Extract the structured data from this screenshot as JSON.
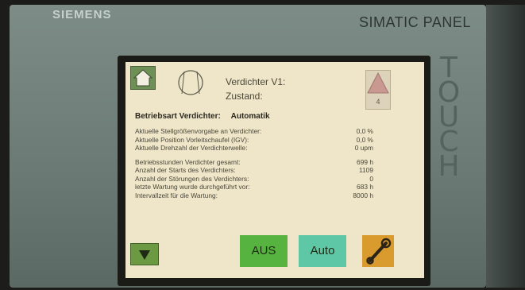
{
  "device": {
    "brand": "SIEMENS",
    "model": "SIMATIC PANEL",
    "side_label": "TOUCH"
  },
  "header": {
    "title": "Verdichter V1:",
    "state_label": "Zustand:",
    "alarm_count": "4"
  },
  "mode": {
    "label": "Betriebsart Verdichter:",
    "value": "Automatik"
  },
  "group1": [
    {
      "label": "Aktuelle Stellgrößenvorgabe an Verdichter:",
      "value": "0,0 %"
    },
    {
      "label": "Aktuelle Position Vorleitschaufel (IGV):",
      "value": "0,0 %"
    },
    {
      "label": "Aktuelle Drehzahl der Verdichterwelle:",
      "value": "0 upm"
    }
  ],
  "group2": [
    {
      "label": "Betriebsstunden Verdichter gesamt:",
      "value": "699 h"
    },
    {
      "label": "Anzahl der Starts des Verdichters:",
      "value": "1109"
    },
    {
      "label": "Anzahl der Störungen des Verdichters:",
      "value": "0"
    },
    {
      "label": "letzte Wartung wurde durchgeführt vor:",
      "value": "683 h"
    },
    {
      "label": "Intervallzeit für die Wartung:",
      "value": "8000 h"
    }
  ],
  "buttons": {
    "off_label": "AUS",
    "auto_label": "Auto"
  },
  "icons": {
    "home": "home-icon",
    "compressor": "compressor-icon",
    "warning": "warning-triangle-icon",
    "down": "down-arrow-icon",
    "tools": "wrench-icon"
  },
  "colors": {
    "screen_bg": "#efe6c9",
    "aus_button": "#57b33f",
    "auto_button": "#5ec7a5",
    "tools_button": "#d99b2d",
    "nav_button": "#6b9a43"
  }
}
